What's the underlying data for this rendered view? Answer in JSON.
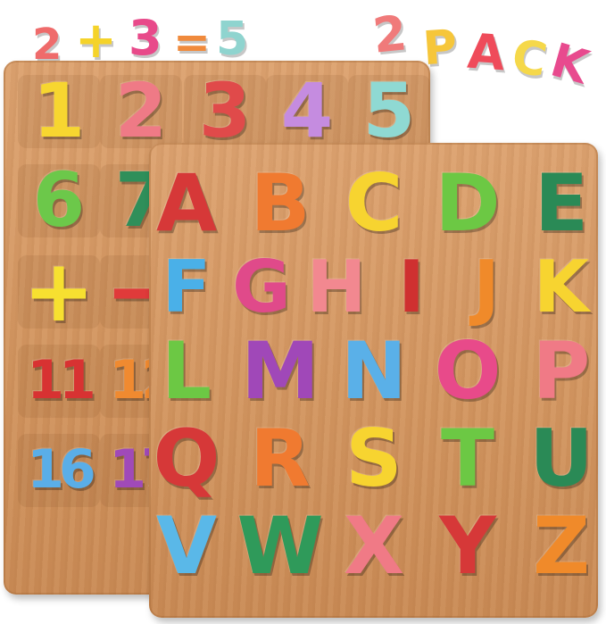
{
  "headline": {
    "equation": [
      {
        "char": "2",
        "color": "#ef6b6b"
      },
      {
        "char": "+",
        "color": "#f5d32a"
      },
      {
        "char": "3",
        "color": "#e84a8a"
      },
      {
        "char": "=",
        "color": "#f08a3c"
      },
      {
        "char": "5",
        "color": "#8fd4cf"
      }
    ],
    "pack": [
      {
        "char": "2",
        "color": "#f07a7a"
      },
      {
        "char": "P",
        "color": "#f6c63a"
      },
      {
        "char": "A",
        "color": "#ef4b5a"
      },
      {
        "char": "C",
        "color": "#f5d84a"
      },
      {
        "char": "K",
        "color": "#e84a8e"
      }
    ]
  },
  "number_board": {
    "rows": [
      [
        {
          "t": "1",
          "c": "#f7d630"
        },
        {
          "t": "2",
          "c": "#ef7a86"
        },
        {
          "t": "3",
          "c": "#e04a4a"
        },
        {
          "t": "4",
          "c": "#c58ce0"
        },
        {
          "t": "5",
          "c": "#8fd9d3"
        }
      ],
      [
        {
          "t": "6",
          "c": "#6cc84a"
        },
        {
          "t": "7",
          "c": "#2f8f5a"
        },
        {
          "t": "",
          "c": "#000000"
        },
        {
          "t": "",
          "c": "#000000"
        },
        {
          "t": "",
          "c": "#000000"
        }
      ],
      [
        {
          "t": "+",
          "c": "#f7e030"
        },
        {
          "t": "−",
          "c": "#e03a3a"
        },
        {
          "t": "",
          "c": "#000000"
        },
        {
          "t": "",
          "c": "#000000"
        },
        {
          "t": "",
          "c": "#000000"
        }
      ],
      [
        {
          "t": "11",
          "c": "#d83232"
        },
        {
          "t": "12",
          "c": "#f08a30"
        },
        {
          "t": "",
          "c": "#000000"
        },
        {
          "t": "",
          "c": "#000000"
        },
        {
          "t": "",
          "c": "#000000"
        }
      ],
      [
        {
          "t": "16",
          "c": "#5aaee8"
        },
        {
          "t": "17",
          "c": "#a04ab8"
        },
        {
          "t": "",
          "c": "#000000"
        },
        {
          "t": "",
          "c": "#000000"
        },
        {
          "t": "",
          "c": "#000000"
        }
      ]
    ]
  },
  "letter_board": {
    "rows": [
      [
        {
          "t": "A",
          "c": "#d63838"
        },
        {
          "t": "B",
          "c": "#f07a30"
        },
        {
          "t": "C",
          "c": "#f7d430"
        },
        {
          "t": "D",
          "c": "#6cc844"
        },
        {
          "t": "E",
          "c": "#2a8a56"
        }
      ],
      [
        {
          "t": "F",
          "c": "#4ab0e8"
        },
        {
          "t": "G",
          "c": "#e04a8a"
        },
        {
          "t": "H",
          "c": "#f28890"
        },
        {
          "t": "I",
          "c": "#cf3030"
        },
        {
          "t": "J",
          "c": "#f08a2a"
        },
        {
          "t": "K",
          "c": "#f7d430"
        }
      ],
      [
        {
          "t": "L",
          "c": "#6cc844"
        },
        {
          "t": "M",
          "c": "#a048b8"
        },
        {
          "t": "N",
          "c": "#5ab0e8"
        },
        {
          "t": "O",
          "c": "#e84a8a"
        },
        {
          "t": "P",
          "c": "#f07a86"
        }
      ],
      [
        {
          "t": "Q",
          "c": "#d63838"
        },
        {
          "t": "R",
          "c": "#f07a30"
        },
        {
          "t": "S",
          "c": "#f7d430"
        },
        {
          "t": "T",
          "c": "#6cc844"
        },
        {
          "t": "U",
          "c": "#2a8a56"
        }
      ],
      [
        {
          "t": "V",
          "c": "#5ab8e8"
        },
        {
          "t": "W",
          "c": "#2f9a5a"
        },
        {
          "t": "X",
          "c": "#f07a86"
        },
        {
          "t": "Y",
          "c": "#d63838"
        },
        {
          "t": "Z",
          "c": "#f08a2a"
        }
      ]
    ]
  }
}
